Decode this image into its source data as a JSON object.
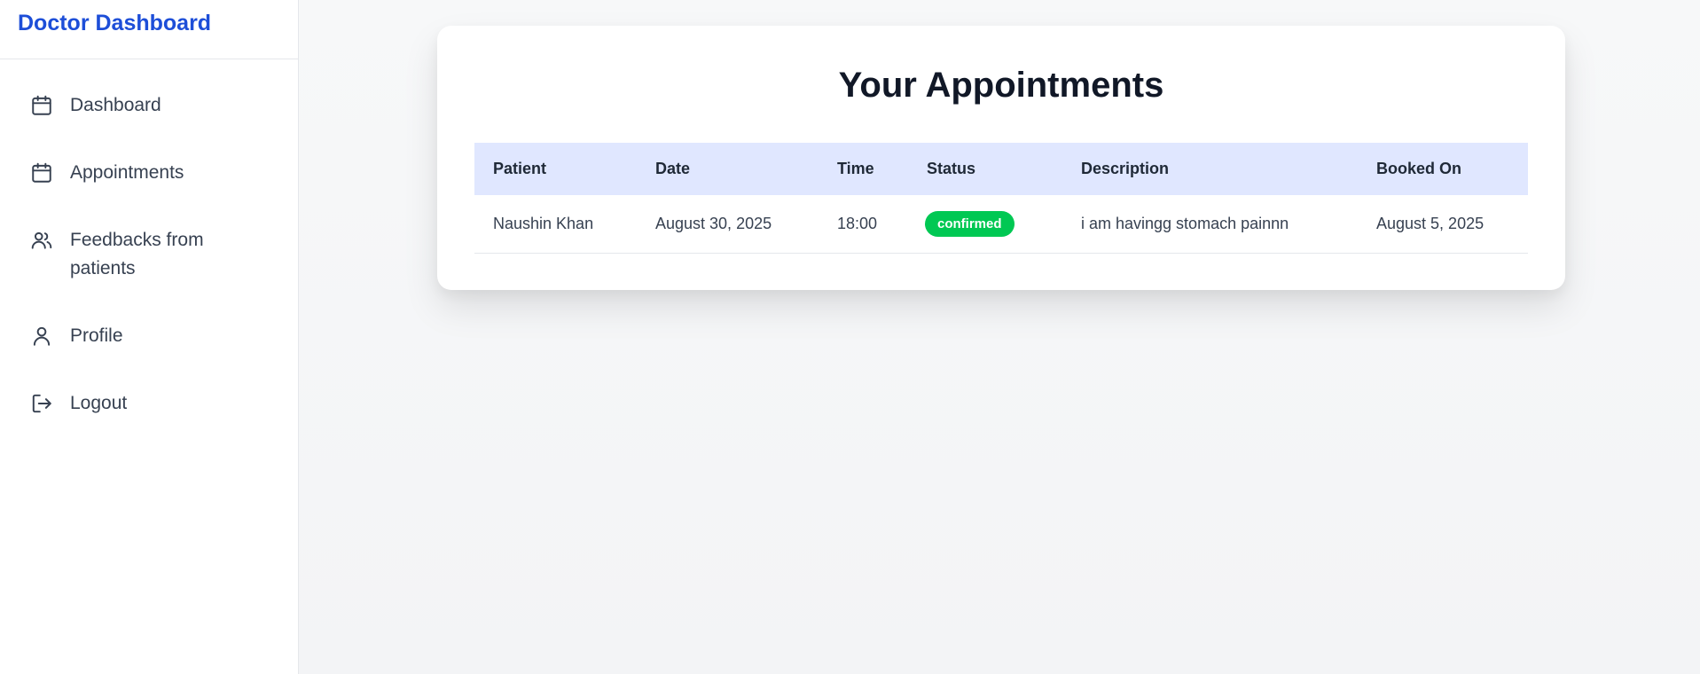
{
  "sidebar": {
    "title": "Doctor Dashboard",
    "items": [
      {
        "label": "Dashboard",
        "icon": "calendar-icon"
      },
      {
        "label": "Appointments",
        "icon": "calendar-icon"
      },
      {
        "label": "Feedbacks from patients",
        "icon": "users-icon"
      },
      {
        "label": "Profile",
        "icon": "user-icon"
      },
      {
        "label": "Logout",
        "icon": "logout-icon"
      }
    ]
  },
  "main": {
    "title": "Your Appointments",
    "table": {
      "headers": [
        "Patient",
        "Date",
        "Time",
        "Status",
        "Description",
        "Booked On"
      ],
      "rows": [
        {
          "patient": "Naushin Khan",
          "date": "August 30, 2025",
          "time": "18:00",
          "status": "confirmed",
          "description": "i am havingg stomach painnn",
          "booked_on": "August 5, 2025"
        }
      ]
    }
  },
  "colors": {
    "brand": "#1d4ed8",
    "header_bg": "#e0e7ff",
    "status_confirmed": "#00c853"
  }
}
